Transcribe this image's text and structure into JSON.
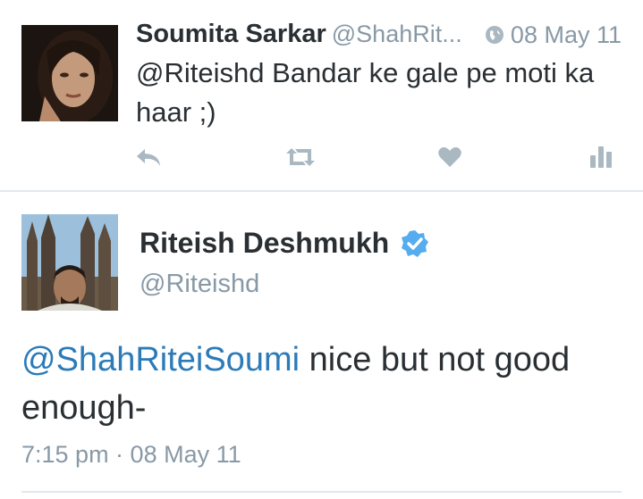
{
  "tweet1": {
    "author_name": "Soumita Sarkar",
    "handle": "@ShahRit...",
    "date": "08 May 11",
    "text": "@Riteishd Bandar ke gale pe moti ka haar ;)",
    "avatar": "woman-portrait-avatar",
    "actions": [
      "reply-icon",
      "retweet-icon",
      "like-icon",
      "stats-icon"
    ]
  },
  "tweet2": {
    "author_name": "Riteish Deshmukh",
    "handle": "@Riteishd",
    "verified": true,
    "mention": "@ShahRiteiSoumi",
    "text": " nice but not good enough-",
    "time": "7:15 pm · 08 May 11",
    "avatar": "man-cathedral-selfie-avatar"
  },
  "colors": {
    "text": "#292f33",
    "secondary": "#8899a6",
    "link": "#2b7bb9",
    "verified": "#55acee",
    "divider": "#e1e8ed",
    "icon": "#aab8c2"
  }
}
